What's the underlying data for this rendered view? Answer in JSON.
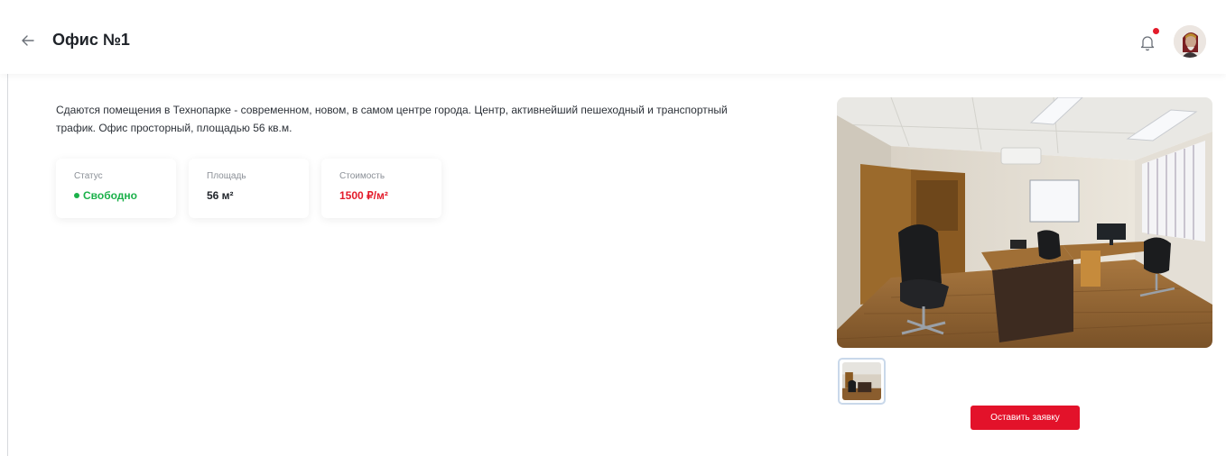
{
  "header": {
    "back_icon": "arrow-left-icon",
    "title": "Офис №1",
    "bell_icon": "bell-icon",
    "has_unread_notifications": true,
    "avatar": "user-avatar"
  },
  "description": "Сдаются помещения в Технопарке - современном, новом, в самом центре города. Центр, активнейший пешеходный и транспортный трафик. Офис просторный, площадью 56 кв.м.",
  "stats": {
    "status": {
      "label": "Статус",
      "value": "Свободно"
    },
    "area": {
      "label": "Площадь",
      "value": "56 м²"
    },
    "price": {
      "label": "Стоимость",
      "value": "1500 ₽/м²"
    }
  },
  "gallery": {
    "main_image": "office-photo",
    "thumbnails": [
      "office-photo"
    ]
  },
  "actions": {
    "apply_label": "Оставить заявку"
  },
  "colors": {
    "accent": "#e3122a",
    "status_free": "#1bb14a",
    "notification_dot": "#e31b2a"
  }
}
